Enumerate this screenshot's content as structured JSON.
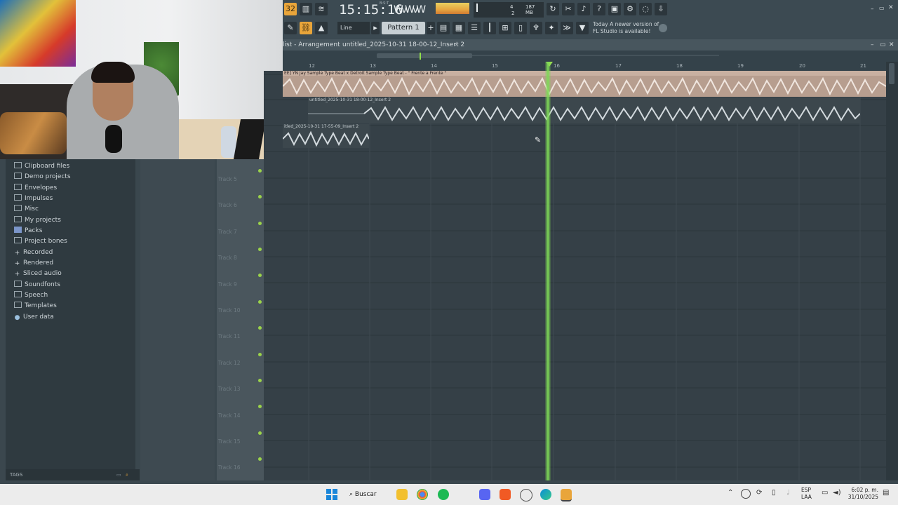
{
  "app": {
    "clock": "15:15:16",
    "clock_small": "B:S:T",
    "cpu_memory": "187 MB",
    "cpu_value_1": "4",
    "cpu_value_2": "2",
    "pattern_name": "Pattern 1",
    "snap_mode": "Line",
    "news_line1": "Today  A newer version of",
    "news_line2": "FL Studio is available!"
  },
  "playlist": {
    "title": "list - Arrangement",
    "breadcrumb": "untitled_2025-10-31 18-00-12_Insert 2",
    "ruler_marks": [
      "12",
      "13",
      "14",
      "15",
      "16",
      "17",
      "18",
      "19",
      "20",
      "21"
    ],
    "clips": [
      {
        "label": "EE] YN Jay Sample Type Beat x Detroit Sample Type Beat - \" Frente a Frente \""
      },
      {
        "label": "untitled_2025-10-31 18-00-12_Insert 2"
      },
      {
        "label": "itled_2025-10-31 17-55-09_Insert 2"
      }
    ],
    "tracks": [
      "Track 5",
      "Track 6",
      "Track 7",
      "Track 8",
      "Track 9",
      "Track 10",
      "Track 11",
      "Track 12",
      "Track 13",
      "Track 14",
      "Track 15",
      "Track 16"
    ]
  },
  "browser": {
    "items": [
      {
        "label": "Clipboard files",
        "icon": "folder-icon"
      },
      {
        "label": "Demo projects",
        "icon": "folder-icon"
      },
      {
        "label": "Envelopes",
        "icon": "folder-icon"
      },
      {
        "label": "Impulses",
        "icon": "folder-icon"
      },
      {
        "label": "Misc",
        "icon": "folder-icon"
      },
      {
        "label": "My projects",
        "icon": "folder-icon"
      },
      {
        "label": "Packs",
        "icon": "packs-icon"
      },
      {
        "label": "Project bones",
        "icon": "folder-icon"
      },
      {
        "label": "Recorded",
        "icon": "plus-icon"
      },
      {
        "label": "Rendered",
        "icon": "plus-icon"
      },
      {
        "label": "Sliced audio",
        "icon": "plus-icon"
      },
      {
        "label": "Soundfonts",
        "icon": "folder-icon"
      },
      {
        "label": "Speech",
        "icon": "folder-icon"
      },
      {
        "label": "Templates",
        "icon": "folder-icon"
      },
      {
        "label": "User data",
        "icon": "user-icon"
      }
    ],
    "tags_label": "TAGS"
  },
  "taskbar": {
    "search_label": "Buscar",
    "lang_line1": "ESP",
    "lang_line2": "LAA",
    "time": "6:02 p. m.",
    "date": "31/10/2025"
  },
  "colors": {
    "accent_green": "#7ed957",
    "clip_color": "#d8c2b4",
    "panel_bg": "#3a474e"
  }
}
